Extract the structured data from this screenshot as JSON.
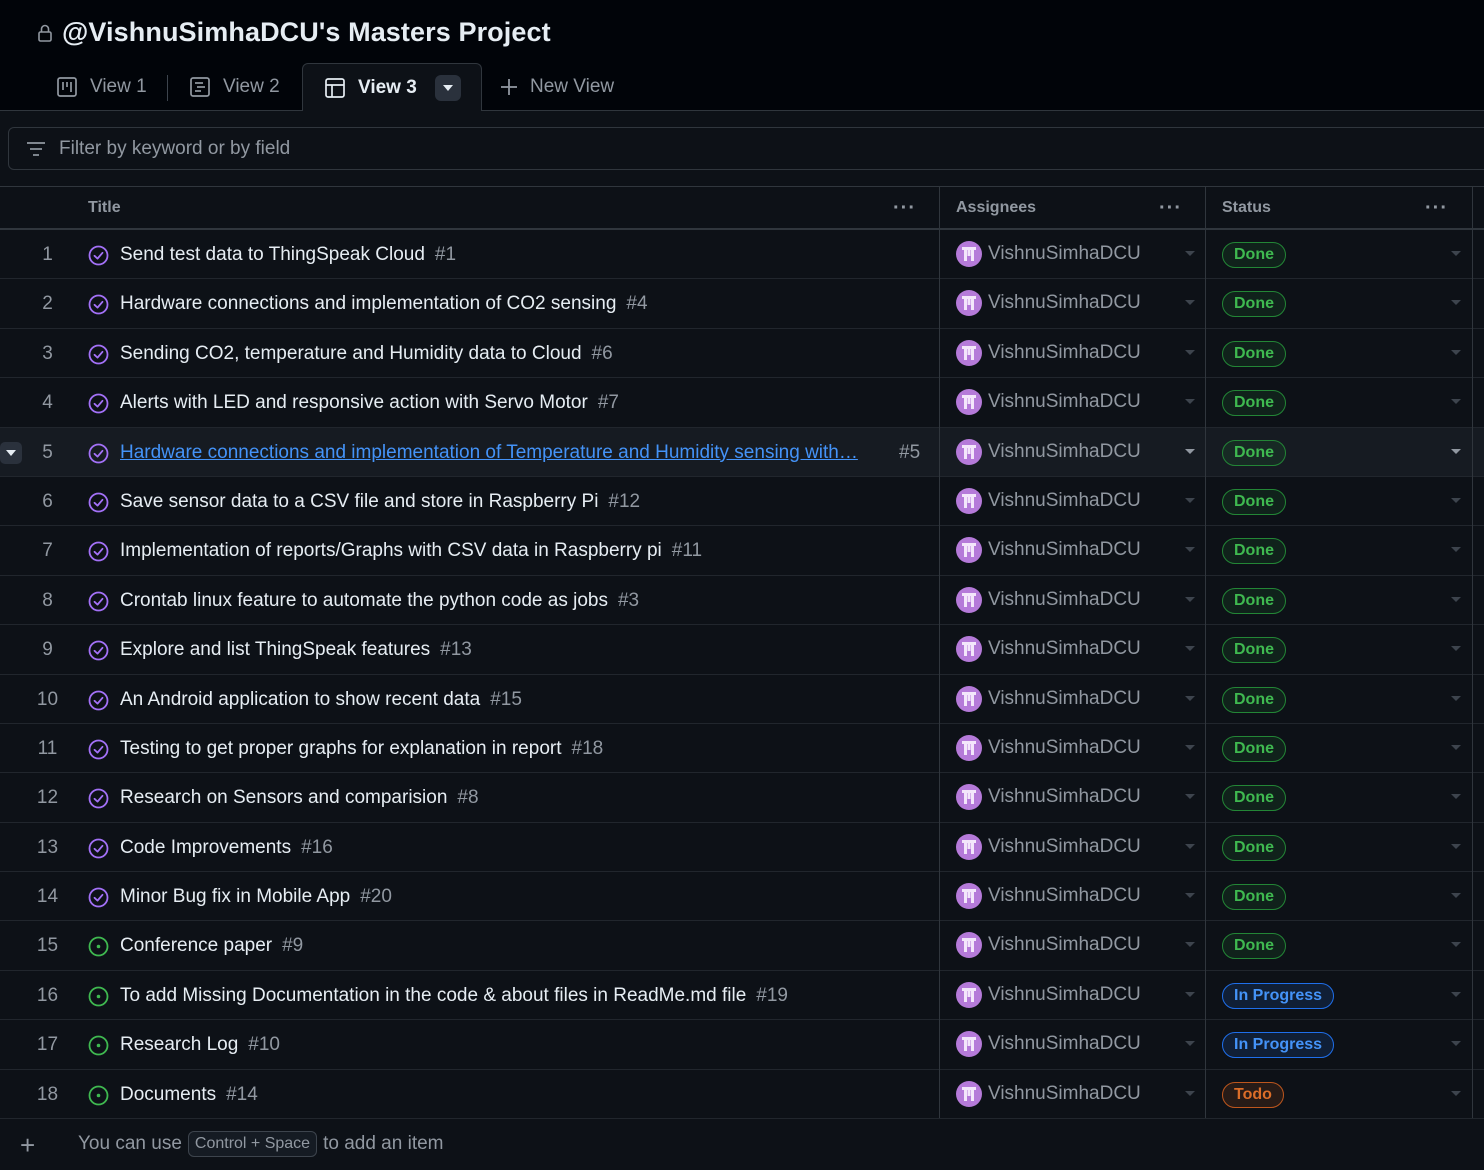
{
  "header": {
    "title": "@VishnuSimhaDCU's Masters Project",
    "icon": "lock-icon"
  },
  "tabs": [
    {
      "label": "View 1",
      "icon": "board-icon"
    },
    {
      "label": "View 2",
      "icon": "roadmap-icon"
    },
    {
      "label": "View 3",
      "icon": "table-icon",
      "active": true
    },
    {
      "label": "New View",
      "icon": "plus-icon"
    }
  ],
  "filter": {
    "placeholder": "Filter by keyword or by field"
  },
  "columns": {
    "title": "Title",
    "assignees": "Assignees",
    "status": "Status"
  },
  "rows": [
    {
      "num": "1",
      "title": "Send test data to ThingSpeak Cloud",
      "issue": "#1",
      "state": "closed",
      "assignee": "VishnuSimhaDCU",
      "status": "Done"
    },
    {
      "num": "2",
      "title": "Hardware connections and implementation of CO2 sensing",
      "issue": "#4",
      "state": "closed",
      "assignee": "VishnuSimhaDCU",
      "status": "Done"
    },
    {
      "num": "3",
      "title": "Sending CO2, temperature and Humidity data to Cloud",
      "issue": "#6",
      "state": "closed",
      "assignee": "VishnuSimhaDCU",
      "status": "Done"
    },
    {
      "num": "4",
      "title": "Alerts with LED and responsive action with Servo Motor",
      "issue": "#7",
      "state": "closed",
      "assignee": "VishnuSimhaDCU",
      "status": "Done"
    },
    {
      "num": "5",
      "title": "Hardware connections and implementation of Temperature and Humidity sensing with…",
      "issue": "#5",
      "state": "closed",
      "assignee": "VishnuSimhaDCU",
      "status": "Done",
      "highlight": true
    },
    {
      "num": "6",
      "title": "Save sensor data to a CSV file and store in Raspberry Pi",
      "issue": "#12",
      "state": "closed",
      "assignee": "VishnuSimhaDCU",
      "status": "Done"
    },
    {
      "num": "7",
      "title": "Implementation of reports/Graphs with CSV data in Raspberry pi",
      "issue": "#11",
      "state": "closed",
      "assignee": "VishnuSimhaDCU",
      "status": "Done"
    },
    {
      "num": "8",
      "title": "Crontab linux feature to automate the python code as jobs",
      "issue": "#3",
      "state": "closed",
      "assignee": "VishnuSimhaDCU",
      "status": "Done"
    },
    {
      "num": "9",
      "title": "Explore and list ThingSpeak features",
      "issue": "#13",
      "state": "closed",
      "assignee": "VishnuSimhaDCU",
      "status": "Done"
    },
    {
      "num": "10",
      "title": "An Android application to show recent data",
      "issue": "#15",
      "state": "closed",
      "assignee": "VishnuSimhaDCU",
      "status": "Done"
    },
    {
      "num": "11",
      "title": "Testing to get proper graphs for explanation in report",
      "issue": "#18",
      "state": "closed",
      "assignee": "VishnuSimhaDCU",
      "status": "Done"
    },
    {
      "num": "12",
      "title": "Research on Sensors and comparision",
      "issue": "#8",
      "state": "closed",
      "assignee": "VishnuSimhaDCU",
      "status": "Done"
    },
    {
      "num": "13",
      "title": "Code Improvements",
      "issue": "#16",
      "state": "closed",
      "assignee": "VishnuSimhaDCU",
      "status": "Done"
    },
    {
      "num": "14",
      "title": "Minor Bug fix in Mobile App",
      "issue": "#20",
      "state": "closed",
      "assignee": "VishnuSimhaDCU",
      "status": "Done"
    },
    {
      "num": "15",
      "title": "Conference paper",
      "issue": "#9",
      "state": "open",
      "assignee": "VishnuSimhaDCU",
      "status": "Done"
    },
    {
      "num": "16",
      "title": "To add Missing Documentation in the code & about files in ReadMe.md file",
      "issue": "#19",
      "state": "open",
      "assignee": "VishnuSimhaDCU",
      "status": "In Progress"
    },
    {
      "num": "17",
      "title": "Research Log",
      "issue": "#10",
      "state": "open",
      "assignee": "VishnuSimhaDCU",
      "status": "In Progress"
    },
    {
      "num": "18",
      "title": "Documents",
      "issue": "#14",
      "state": "open",
      "assignee": "VishnuSimhaDCU",
      "status": "Todo"
    }
  ],
  "footer": {
    "hint_before": "You can use",
    "shortcut": "Control + Space",
    "hint_after": "to add an item"
  },
  "colors": {
    "closed": "#a371f7",
    "open": "#3fb950",
    "done": "#3fb950",
    "in_progress": "#4493f8",
    "todo": "#db6d28",
    "avatar": "#b57ad9"
  }
}
